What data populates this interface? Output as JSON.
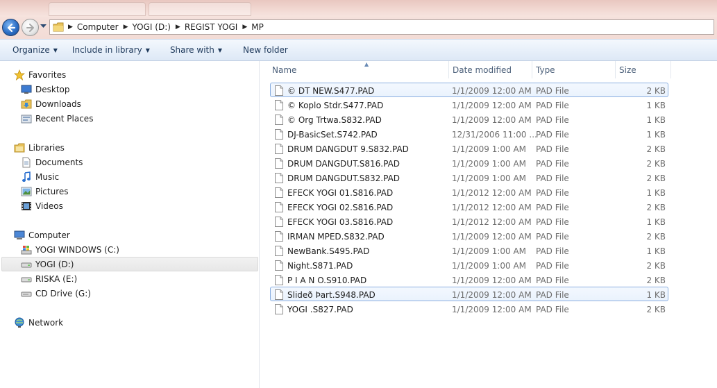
{
  "window": {
    "address": [
      "Computer",
      "YOGI (D:)",
      "REGIST YOGI",
      "MP"
    ]
  },
  "toolbar": {
    "organize": "Organize",
    "include": "Include in library",
    "share": "Share with",
    "new_folder": "New folder"
  },
  "nav": {
    "favorites": "Favorites",
    "desktop": "Desktop",
    "downloads": "Downloads",
    "recent": "Recent Places",
    "libraries": "Libraries",
    "documents": "Documents",
    "music": "Music",
    "pictures": "Pictures",
    "videos": "Videos",
    "computer": "Computer",
    "drive_c": "YOGI WINDOWS (C:)",
    "drive_d": "YOGI (D:)",
    "drive_e": "RISKA (E:)",
    "drive_g": "CD Drive (G:)",
    "network": "Network"
  },
  "columns": {
    "name": "Name",
    "date": "Date modified",
    "type": "Type",
    "size": "Size"
  },
  "files": [
    {
      "name": "© DT  NEW.S477.PAD",
      "date": "1/1/2009 12:00 AM",
      "type": "PAD File",
      "size": "2 KB"
    },
    {
      "name": "© Koplo Stdr.S477.PAD",
      "date": "1/1/2009 12:00 AM",
      "type": "PAD File",
      "size": "1 KB"
    },
    {
      "name": "© Org Trtwa.S832.PAD",
      "date": "1/1/2009 12:00 AM",
      "type": "PAD File",
      "size": "1 KB"
    },
    {
      "name": "DJ-BasicSet.S742.PAD",
      "date": "12/31/2006 11:00 ...",
      "type": "PAD File",
      "size": "1 KB"
    },
    {
      "name": "DRUM DANGDUT 9.S832.PAD",
      "date": "1/1/2009 1:00 AM",
      "type": "PAD File",
      "size": "2 KB"
    },
    {
      "name": "DRUM DANGDUT.S816.PAD",
      "date": "1/1/2009 1:00 AM",
      "type": "PAD File",
      "size": "2 KB"
    },
    {
      "name": "DRUM DANGDUT.S832.PAD",
      "date": "1/1/2009 1:00 AM",
      "type": "PAD File",
      "size": "2 KB"
    },
    {
      "name": "EFECK YOGI 01.S816.PAD",
      "date": "1/1/2012 12:00 AM",
      "type": "PAD File",
      "size": "1 KB"
    },
    {
      "name": "EFECK YOGI 02.S816.PAD",
      "date": "1/1/2012 12:00 AM",
      "type": "PAD File",
      "size": "2 KB"
    },
    {
      "name": "EFECK YOGI 03.S816.PAD",
      "date": "1/1/2012 12:00 AM",
      "type": "PAD File",
      "size": "1 KB"
    },
    {
      "name": "IRMAN MPED.S832.PAD",
      "date": "1/1/2009 12:00 AM",
      "type": "PAD File",
      "size": "2 KB"
    },
    {
      "name": "NewBank.S495.PAD",
      "date": "1/1/2009 1:00 AM",
      "type": "PAD File",
      "size": "1 KB"
    },
    {
      "name": "Night.S871.PAD",
      "date": "1/1/2009 1:00 AM",
      "type": "PAD File",
      "size": "2 KB"
    },
    {
      "name": "P I A N O.S910.PAD",
      "date": "1/1/2009 12:00 AM",
      "type": "PAD File",
      "size": "2 KB"
    },
    {
      "name": "Slideð Þart.S948.PAD",
      "date": "1/1/2009 12:00 AM",
      "type": "PAD File",
      "size": "1 KB"
    },
    {
      "name": "YOGI .S827.PAD",
      "date": "1/1/2009 12:00 AM",
      "type": "PAD File",
      "size": "2 KB"
    }
  ],
  "colors": {
    "accent": "#1e395b",
    "selection_border": "#8aaee0",
    "muted_text": "#6d6d6d"
  }
}
